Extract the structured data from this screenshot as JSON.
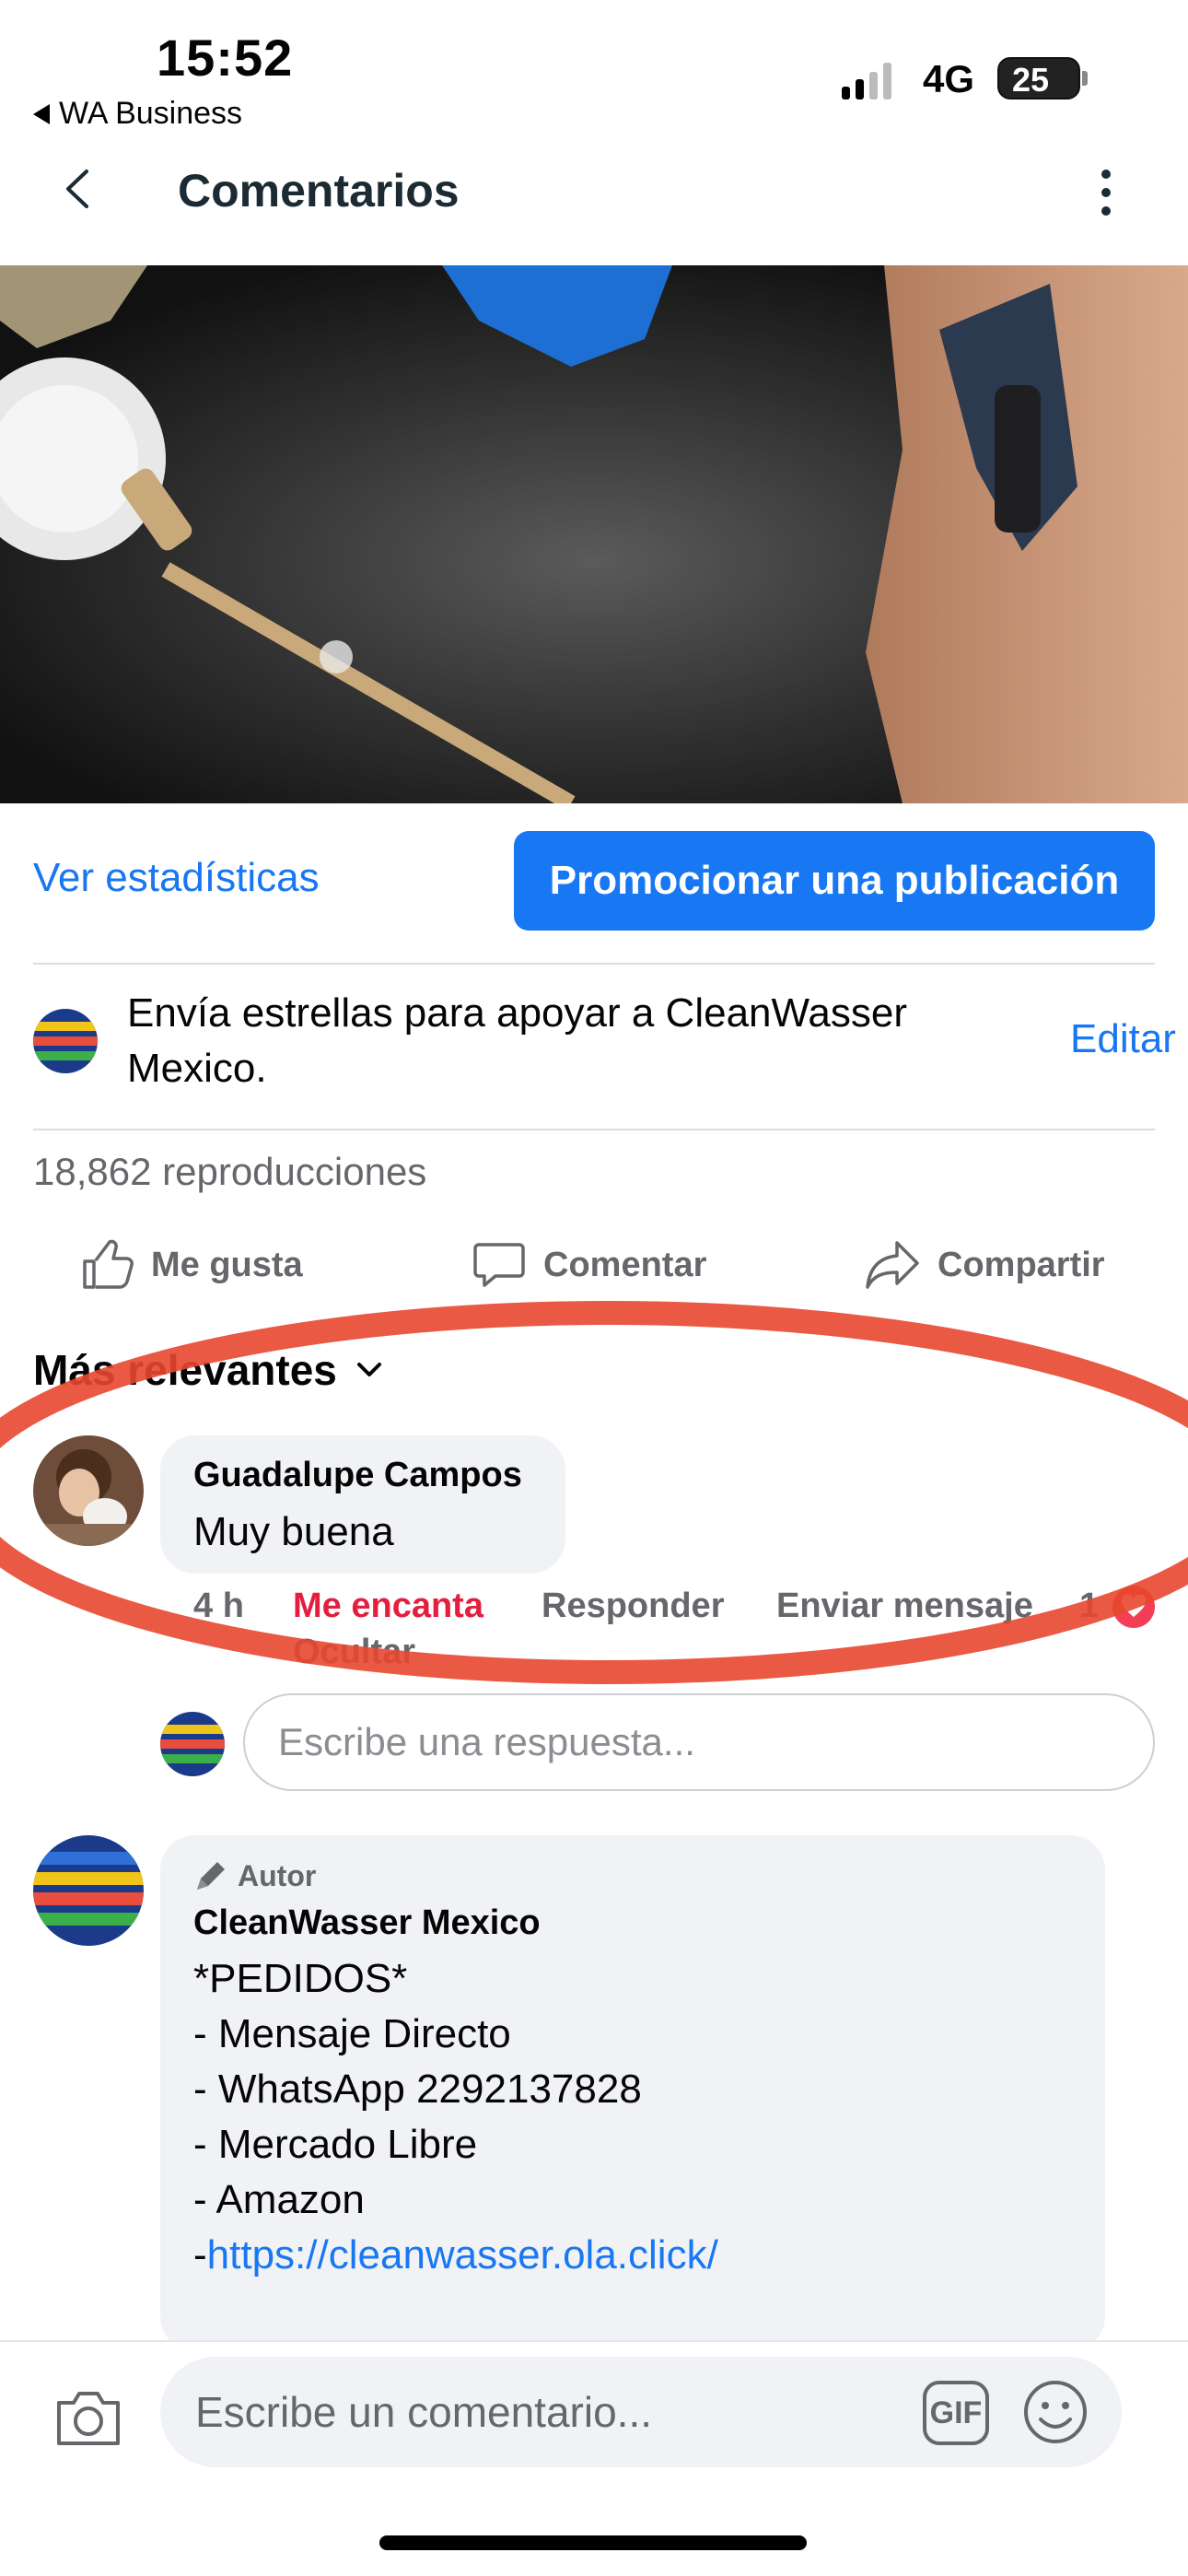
{
  "status_bar": {
    "time": "15:52",
    "back_app": "WA Business",
    "network": "4G",
    "battery": "25"
  },
  "nav": {
    "title": "Comentarios"
  },
  "actions": {
    "stats": "Ver estadísticas",
    "promote": "Promocionar una publicación"
  },
  "stars": {
    "text": "Envía estrellas para apoyar a CleanWasser Mexico.",
    "edit": "Editar"
  },
  "views": "18,862 reproducciones",
  "reactions": {
    "like": "Me gusta",
    "comment": "Comentar",
    "share": "Compartir"
  },
  "sort": "Más relevantes",
  "comment1": {
    "name": "Guadalupe Campos",
    "text": "Muy buena",
    "time": "4 h",
    "reaction": "Me encanta",
    "reply": "Responder",
    "message": "Enviar mensaje",
    "count": "1",
    "hide": "Ocultar",
    "reply_placeholder": "Escribe una respuesta..."
  },
  "comment2": {
    "badge": "Autor",
    "name": "CleanWasser Mexico",
    "line1": "*PEDIDOS*",
    "line2": "- Mensaje Directo",
    "line3": "- WhatsApp 2292137828",
    "line4": "- Mercado Libre",
    "line5": "- Amazon",
    "line6_prefix": "-",
    "line6_link": "https://cleanwasser.ola.click/"
  },
  "bottom": {
    "placeholder": "Escribe un comentario...",
    "gif": "GIF"
  },
  "colors": {
    "accent": "#1877f2",
    "love": "#f33e58",
    "annotation": "#e8472f"
  }
}
